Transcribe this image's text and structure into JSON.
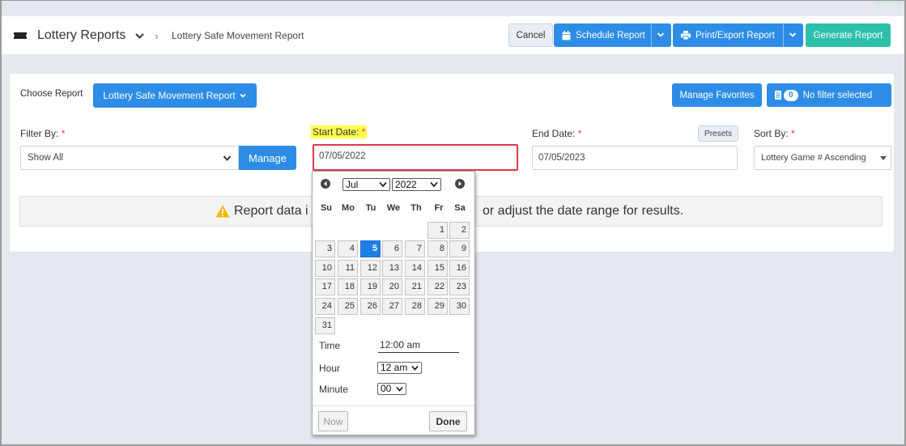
{
  "header": {
    "title": "Lottery Reports",
    "breadcrumb_separator": "›",
    "subtitle": "Lottery Safe Movement Report",
    "cancel_label": "Cancel",
    "schedule_label": "Schedule Report",
    "print_label": "Print/Export Report",
    "generate_label": "Generate Report"
  },
  "toolbar": {
    "choose_report_label": "Choose Report",
    "report_select_label": "Lottery Safe Movement Report",
    "manage_favorites_label": "Manage Favorites",
    "filter_count": "0",
    "filter_label": "No filter selected"
  },
  "filters": {
    "filter_by_label": "Filter By:",
    "filter_by_value": "Show All",
    "manage_label": "Manage",
    "start_date_label": "Start Date:",
    "start_date_value": "07/05/2022",
    "end_date_label": "End Date:",
    "end_date_value": "07/05/2023",
    "presets_label": "Presets",
    "sort_by_label": "Sort By:",
    "sort_by_value": "Lottery Game # Ascending",
    "required_mark": "*"
  },
  "alert": {
    "text_left": "Report data i",
    "text_right": "or adjust the date range for results."
  },
  "datepicker": {
    "month": "Jul",
    "year": "2022",
    "weekdays": [
      "Su",
      "Mo",
      "Tu",
      "We",
      "Th",
      "Fr",
      "Sa"
    ],
    "days": [
      [
        "",
        "",
        "",
        "",
        "",
        "1",
        "2"
      ],
      [
        "3",
        "4",
        "5",
        "6",
        "7",
        "8",
        "9"
      ],
      [
        "10",
        "11",
        "12",
        "13",
        "14",
        "15",
        "16"
      ],
      [
        "17",
        "18",
        "19",
        "20",
        "21",
        "22",
        "23"
      ],
      [
        "24",
        "25",
        "26",
        "27",
        "28",
        "29",
        "30"
      ],
      [
        "31",
        "",
        "",
        "",
        "",
        "",
        ""
      ]
    ],
    "selected_day": "5",
    "time_label": "Time",
    "time_value": "12:00 am",
    "hour_label": "Hour",
    "hour_value": "12 am",
    "minute_label": "Minute",
    "minute_value": "00",
    "now_label": "Now",
    "done_label": "Done"
  },
  "colors": {
    "primary": "#2d8de6",
    "success": "#2dbfa9",
    "required": "#e0384b",
    "highlight": "#ffff4d",
    "selected_day": "#1d7fe8"
  }
}
